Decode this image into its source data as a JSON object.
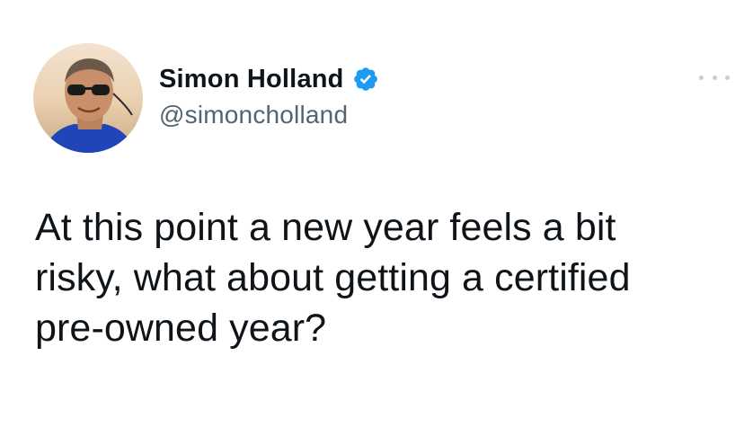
{
  "author": {
    "display_name": "Simon Holland",
    "handle": "@simoncholland",
    "verified": true,
    "verified_color": "#1d9bf0"
  },
  "tweet": {
    "lines": [
      "At this point a new year feels a bit",
      "risky, what about getting a certified",
      "pre-owned year?"
    ]
  },
  "menu": {
    "icon": "more-dots-icon"
  },
  "colors": {
    "text": "#0f1419",
    "secondary": "#536471",
    "background": "#ffffff"
  }
}
